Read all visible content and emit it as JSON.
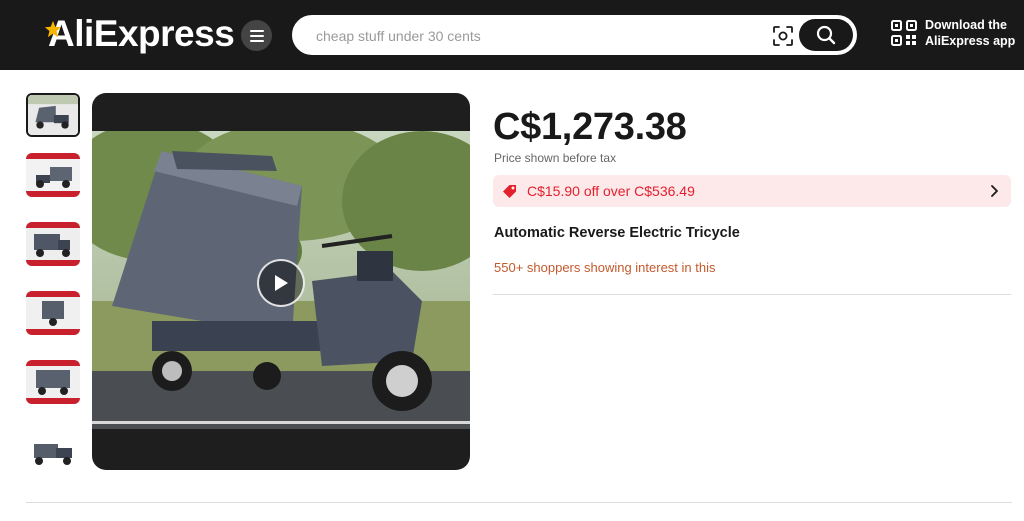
{
  "header": {
    "logo_text": "AliExpress",
    "search": {
      "placeholder": "cheap stuff under 30 cents",
      "value": ""
    },
    "app_download": {
      "line1": "Download the",
      "line2": "AliExpress app"
    }
  },
  "gallery": {
    "thumbnails": [
      {
        "active": true
      },
      {
        "active": false
      },
      {
        "active": false
      },
      {
        "active": false
      },
      {
        "active": false
      },
      {
        "active": false
      }
    ]
  },
  "product": {
    "price": "C$1,273.38",
    "price_note": "Price shown before tax",
    "coupon": "C$15.90 off over C$536.49",
    "title": "Automatic Reverse Electric Tricycle",
    "interest": "550+ shoppers showing interest in this"
  },
  "colors": {
    "header_bg": "#191919",
    "coupon_bg": "#fde9ea",
    "coupon_text": "#e4202d",
    "interest_text": "#c35a2e"
  }
}
